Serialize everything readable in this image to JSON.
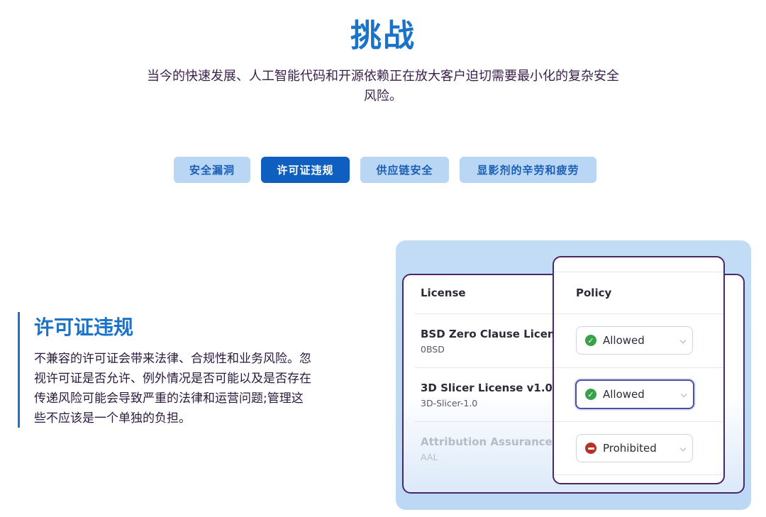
{
  "header": {
    "title": "挑战",
    "intro_line1": "当今的快速发展、人工智能代码和开源依赖正在放大客户迫切需要最小化的复杂安全",
    "intro_line2": "风险。"
  },
  "tabs": [
    {
      "label": "安全漏洞",
      "active": false
    },
    {
      "label": "许可证违规",
      "active": true
    },
    {
      "label": "供应链安全",
      "active": false
    },
    {
      "label": "显影剂的辛劳和疲劳",
      "active": false
    }
  ],
  "section": {
    "title": "许可证违规",
    "body": "不兼容的许可证会带来法律、合规性和业务风险。忽视许可证是否允许、例外情况是否可能以及是否存在传递风险可能会导致严重的法律和运营问题;管理这些不应该是一个单独的负担。"
  },
  "license_table": {
    "license_header": "License",
    "policy_header": "Policy",
    "rows": [
      {
        "name": "BSD Zero Clause License",
        "id": "0BSD",
        "policy": "Allowed",
        "status": "allowed",
        "icon": "check-circle-icon"
      },
      {
        "name": "3D Slicer License v1.0",
        "id": "3D-Slicer-1.0",
        "policy": "Allowed",
        "status": "allowed",
        "icon": "check-circle-icon"
      },
      {
        "name": "Attribution Assurance Lic",
        "id": "AAL",
        "policy": "Prohibited",
        "status": "prohibited",
        "icon": "no-entry-icon"
      }
    ]
  },
  "colors": {
    "accent": "#1a73c8",
    "active_tab": "#0e5fc0",
    "tab": "#b9d6f5",
    "card_border": "#4a2766",
    "allowed": "#3aa14b",
    "prohibited": "#b53227"
  }
}
